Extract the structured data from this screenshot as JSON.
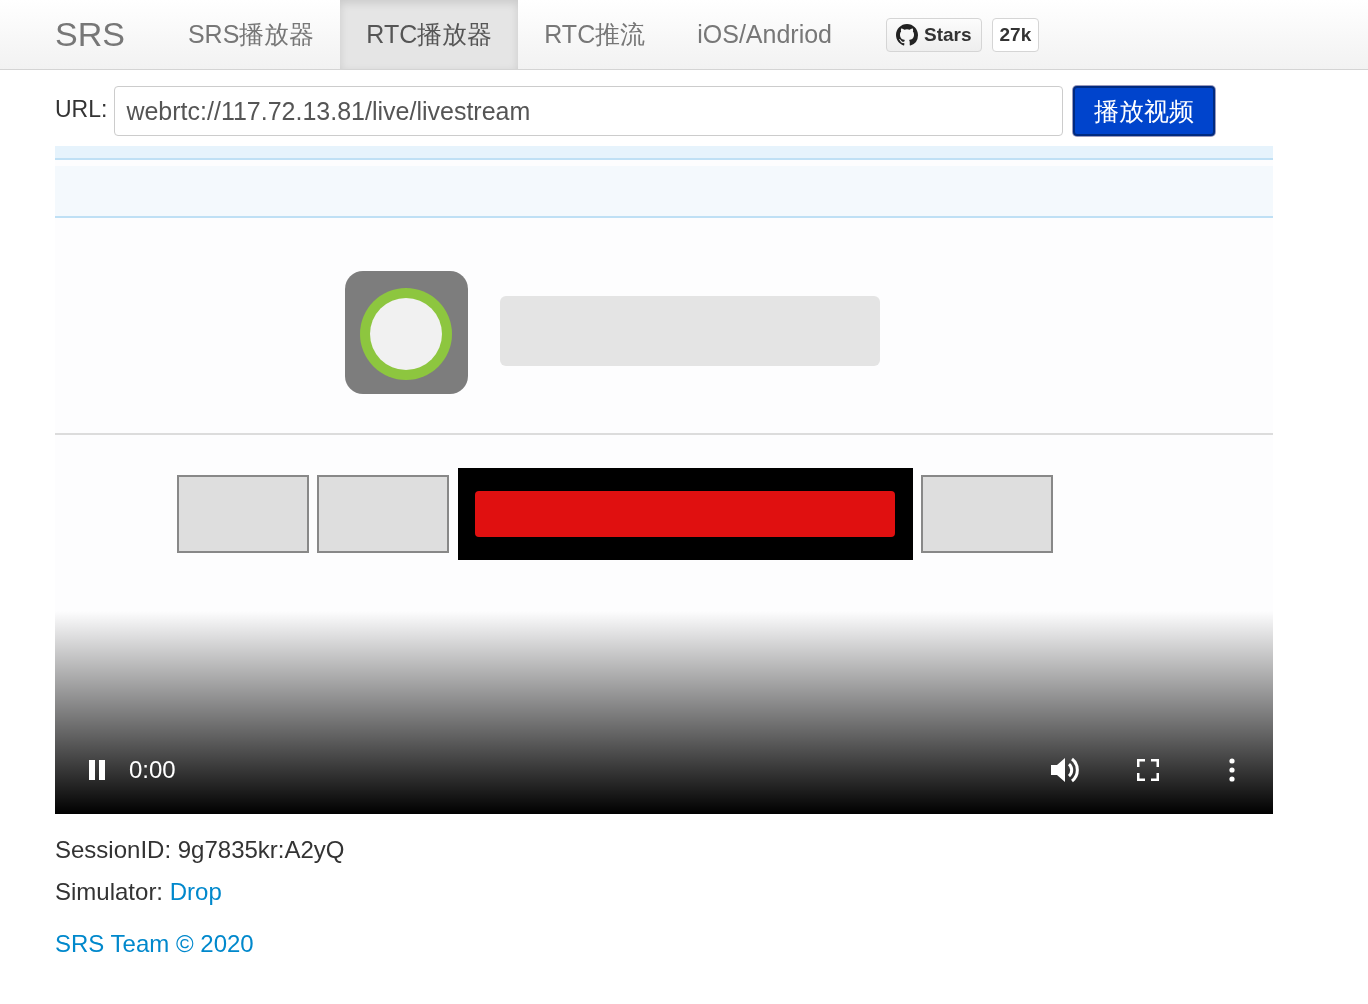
{
  "navbar": {
    "brand": "SRS",
    "tabs": [
      {
        "label": "SRS播放器",
        "selected": false
      },
      {
        "label": "RTC播放器",
        "selected": true
      },
      {
        "label": "RTC推流",
        "selected": false
      },
      {
        "label": "iOS/Andriod",
        "selected": false
      }
    ],
    "github": {
      "label": "Stars",
      "count": "27k"
    }
  },
  "url_bar": {
    "label": "URL:",
    "value": "webrtc://117.72.13.81/live/livestream",
    "button": "播放视频"
  },
  "video": {
    "kind": "picture",
    "playing": true,
    "time": "0:00"
  },
  "info": {
    "session_label": "SessionID:",
    "session_id": "9g7835kr:A2yQ",
    "simulator_label": "Simulator:",
    "simulator_link": "Drop"
  },
  "footer": "SRS Team © 2020"
}
